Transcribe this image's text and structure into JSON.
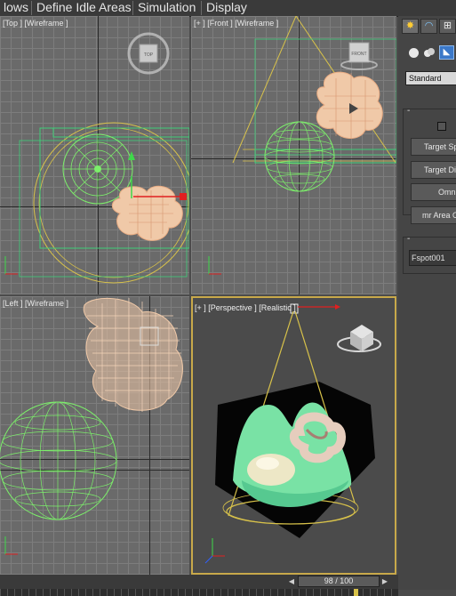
{
  "menu": {
    "items": [
      "lows",
      "Define Idle Areas",
      "Simulation",
      "Display"
    ]
  },
  "viewports": {
    "top": {
      "label": "[Top ] [Wireframe ]",
      "viewcube": "TOP"
    },
    "front": {
      "label": "[+ ] [Front ] [Wireframe ]",
      "viewcube": "FRONT"
    },
    "left": {
      "label": "[Left ] [Wireframe ]"
    },
    "perspective": {
      "label": "[+ ] [Perspective ] [Realistic ]"
    }
  },
  "command_panel": {
    "tab_icons": [
      "create-icon",
      "modify-icon",
      "hierarchy-icon"
    ],
    "category_icons": [
      "geometry-icon",
      "shapes-icon",
      "lights-icon"
    ],
    "dropdown_value": "Standard",
    "object_types": [
      "Target Sp",
      "Target Dir",
      "Omni",
      "mr Area O"
    ],
    "object_name": "Fspot001"
  },
  "timeline": {
    "frame_display": "98 / 100"
  },
  "colors": {
    "menubar": "#3a3a3a",
    "wire_green": "#7cf06a",
    "wire_peach": "#f3c7a3",
    "wire_yellow": "#d8c24a",
    "active_border": "#c8a94a"
  }
}
